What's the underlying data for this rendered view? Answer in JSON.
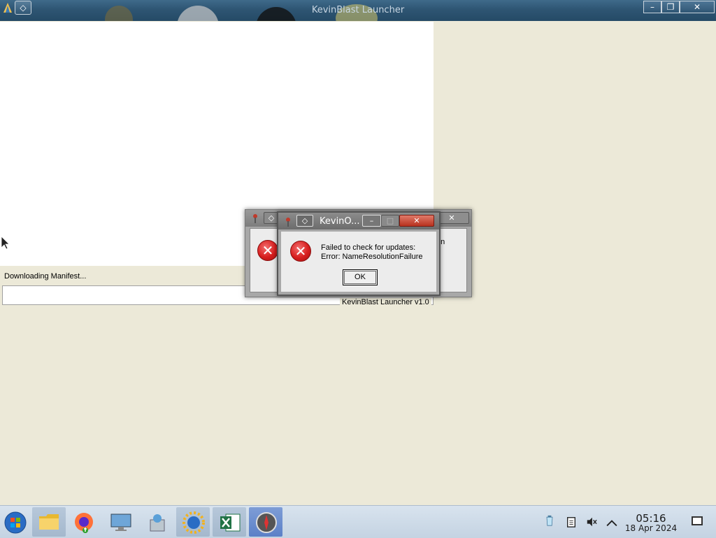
{
  "window": {
    "title": "KevinBlast Launcher",
    "menu_glyph": "◇",
    "controls": {
      "minimize": "–",
      "maximize": "❐",
      "close": "✕"
    }
  },
  "launcher": {
    "status": "Downloading Manifest...",
    "version": "KevinBlast Launcher v1.0",
    "progress": 0
  },
  "dialog_back": {
    "title": "",
    "message_fragment": "on",
    "close": "✕"
  },
  "dialog_front": {
    "title": "KevinO...",
    "menu_glyph": "◇",
    "message_line1": "Failed to check for updates:",
    "message_line2": "Error: NameResolutionFailure",
    "ok_label": "OK",
    "error_glyph": "✕",
    "controls": {
      "minimize": "–",
      "maximize": "□",
      "close": "✕"
    }
  },
  "taskbar": {
    "items": [
      {
        "name": "start-button",
        "icon": "windows-orb-icon"
      },
      {
        "name": "file-explorer",
        "icon": "folder-icon"
      },
      {
        "name": "firefox",
        "icon": "firefox-icon"
      },
      {
        "name": "remote-desktop",
        "icon": "monitor-icon"
      },
      {
        "name": "installer",
        "icon": "package-icon"
      },
      {
        "name": "kevinblast",
        "icon": "sun-icon"
      },
      {
        "name": "excel",
        "icon": "excel-icon"
      },
      {
        "name": "compass-app",
        "icon": "compass-icon"
      }
    ],
    "clock_time": "05:16",
    "clock_date": "18 Apr 2024"
  }
}
